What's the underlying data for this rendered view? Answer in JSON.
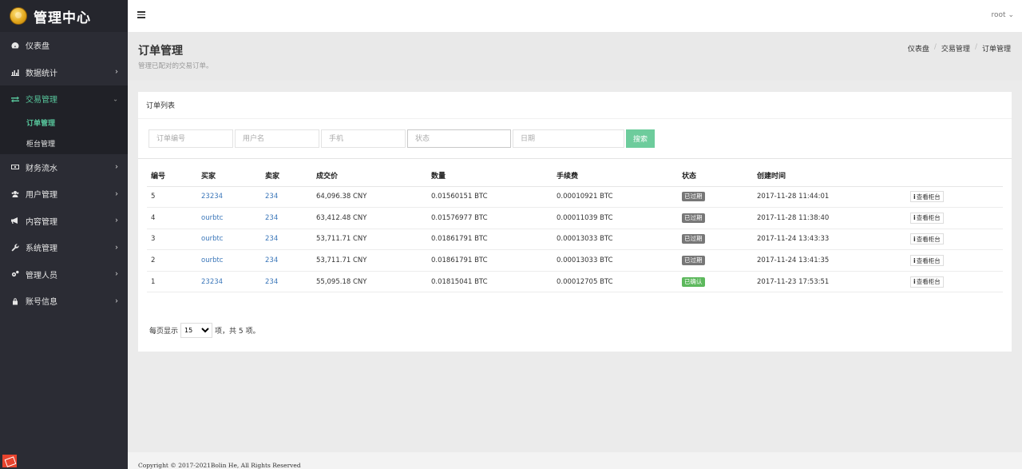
{
  "brand": {
    "title": "管理中心"
  },
  "sidebar": {
    "items": [
      {
        "label": "仪表盘",
        "icon": "dashboard-icon",
        "has_children": false
      },
      {
        "label": "数据统计",
        "icon": "bar-chart-icon",
        "has_children": true
      },
      {
        "label": "交易管理",
        "icon": "exchange-icon",
        "has_children": true,
        "active": true,
        "children": [
          {
            "label": "订单管理",
            "current": true
          },
          {
            "label": "柜台管理"
          }
        ]
      },
      {
        "label": "财务流水",
        "icon": "money-icon",
        "has_children": true
      },
      {
        "label": "用户管理",
        "icon": "users-icon",
        "has_children": true
      },
      {
        "label": "内容管理",
        "icon": "bullhorn-icon",
        "has_children": true
      },
      {
        "label": "系统管理",
        "icon": "wrench-icon",
        "has_children": true
      },
      {
        "label": "管理人员",
        "icon": "cogs-icon",
        "has_children": true
      },
      {
        "label": "账号信息",
        "icon": "lock-icon",
        "has_children": true
      }
    ]
  },
  "topbar": {
    "user": "root"
  },
  "page": {
    "title": "订单管理",
    "subtitle": "管理已配对的交易订单。",
    "breadcrumb": [
      "仪表盘",
      "交易管理",
      "订单管理"
    ]
  },
  "card": {
    "title": "订单列表"
  },
  "filters": {
    "order_no_placeholder": "订单编号",
    "username_placeholder": "用户名",
    "phone_placeholder": "手机",
    "status_placeholder": "状态",
    "date_placeholder": "日期",
    "search_label": "搜索"
  },
  "table": {
    "columns": [
      "编号",
      "买家",
      "卖家",
      "成交价",
      "数量",
      "手续费",
      "状态",
      "创建时间",
      ""
    ],
    "rows": [
      {
        "id": "5",
        "buyer": "23234",
        "seller": "234",
        "price": "64,096.38 CNY",
        "amount": "0.01560151 BTC",
        "fee": "0.00010921 BTC",
        "status": "已过期",
        "status_type": "expired",
        "created": "2017-11-28 11:44:01",
        "action": "查看柜台"
      },
      {
        "id": "4",
        "buyer": "ourbtc",
        "seller": "234",
        "price": "63,412.48 CNY",
        "amount": "0.01576977 BTC",
        "fee": "0.00011039 BTC",
        "status": "已过期",
        "status_type": "expired",
        "created": "2017-11-28 11:38:40",
        "action": "查看柜台"
      },
      {
        "id": "3",
        "buyer": "ourbtc",
        "seller": "234",
        "price": "53,711.71 CNY",
        "amount": "0.01861791 BTC",
        "fee": "0.00013033 BTC",
        "status": "已过期",
        "status_type": "expired",
        "created": "2017-11-24 13:43:33",
        "action": "查看柜台"
      },
      {
        "id": "2",
        "buyer": "ourbtc",
        "seller": "234",
        "price": "53,711.71 CNY",
        "amount": "0.01861791 BTC",
        "fee": "0.00013033 BTC",
        "status": "已过期",
        "status_type": "expired",
        "created": "2017-11-24 13:41:35",
        "action": "查看柜台"
      },
      {
        "id": "1",
        "buyer": "23234",
        "seller": "234",
        "price": "55,095.18 CNY",
        "amount": "0.01815041 BTC",
        "fee": "0.00012705 BTC",
        "status": "已确认",
        "status_type": "confirmed",
        "created": "2017-11-23 17:53:51",
        "action": "查看柜台"
      }
    ]
  },
  "pager": {
    "prefix": "每页显示",
    "page_size": "15",
    "suffix": "项，共 5 项。"
  },
  "footer": {
    "copyright": "Copyright © 2017-2021Bolin He, All Rights Reserved"
  },
  "colors": {
    "accent": "#57c59b",
    "sidebar_bg": "#2b2c34",
    "link": "#3a76b9",
    "badge_expired": "#777777",
    "badge_confirmed": "#5cb85c",
    "search_button": "#6dcc9c"
  }
}
